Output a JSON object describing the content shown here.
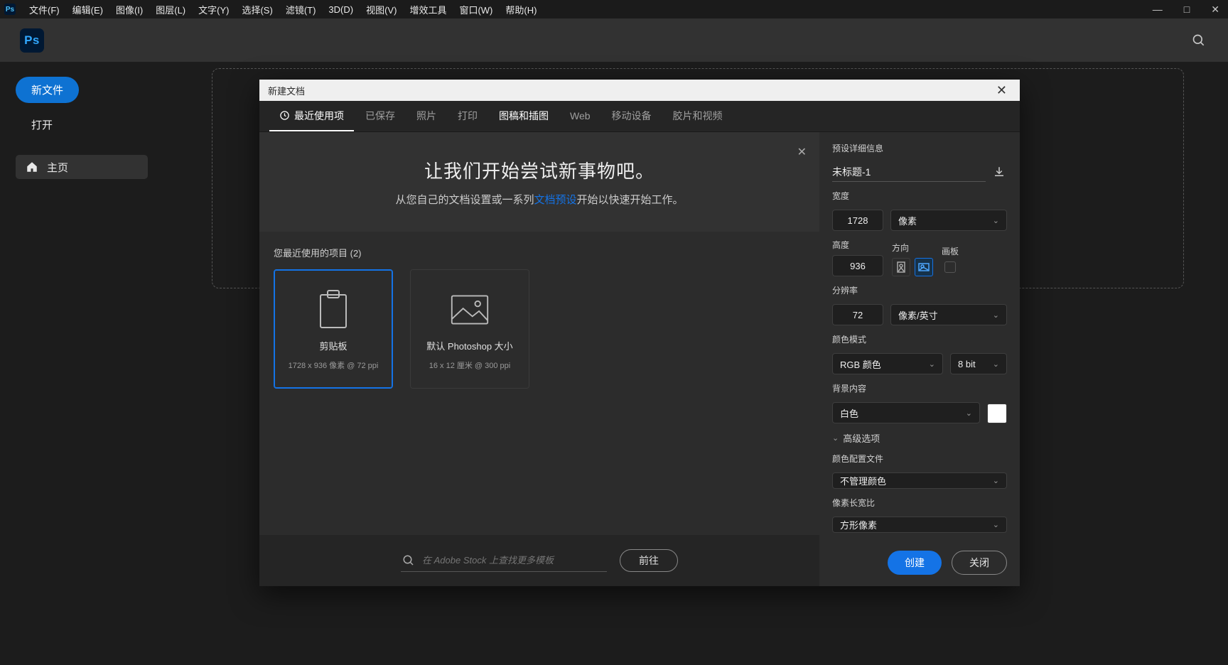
{
  "menubar": {
    "items": [
      "文件(F)",
      "编辑(E)",
      "图像(I)",
      "图层(L)",
      "文字(Y)",
      "选择(S)",
      "滤镜(T)",
      "3D(D)",
      "视图(V)",
      "增效工具",
      "窗口(W)",
      "帮助(H)"
    ]
  },
  "app": {
    "logo_text": "Ps"
  },
  "sidebar": {
    "new_file": "新文件",
    "open": "打开",
    "home": "主页"
  },
  "dialog": {
    "title": "新建文档",
    "tabs": [
      "最近使用项",
      "已保存",
      "照片",
      "打印",
      "图稿和插图",
      "Web",
      "移动设备",
      "胶片和视频"
    ],
    "active_tab": 0,
    "banner": {
      "title": "让我们开始尝试新事物吧。",
      "text_before": "从您自己的文档设置或一系列",
      "link": "文档预设",
      "text_after": "开始以快速开始工作。"
    },
    "recent_label": "您最近使用的项目 (2)",
    "presets": [
      {
        "title": "剪贴板",
        "sub": "1728 x 936 像素 @ 72 ppi"
      },
      {
        "title": "默认 Photoshop 大小",
        "sub": "16 x 12 厘米 @ 300 ppi"
      }
    ],
    "stock_placeholder": "在 Adobe Stock 上查找更多模板",
    "go": "前往"
  },
  "details": {
    "header": "预设详细信息",
    "name": "未标题-1",
    "width_label": "宽度",
    "width": "1728",
    "width_unit": "像素",
    "height_label": "高度",
    "height": "936",
    "orient_label": "方向",
    "artboard_label": "画板",
    "res_label": "分辨率",
    "res": "72",
    "res_unit": "像素/英寸",
    "color_mode_label": "颜色模式",
    "color_mode": "RGB 颜色",
    "bit": "8 bit",
    "bg_label": "背景内容",
    "bg": "白色",
    "advanced": "高级选项",
    "profile_label": "颜色配置文件",
    "profile": "不管理颜色",
    "aspect_label": "像素长宽比",
    "aspect": "方形像素",
    "create": "创建",
    "close": "关闭"
  }
}
